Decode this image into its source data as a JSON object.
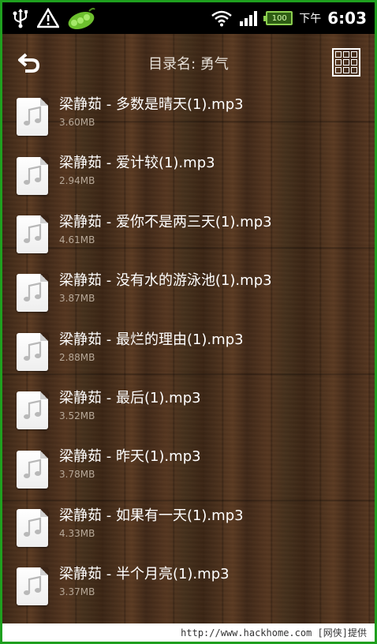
{
  "status_bar": {
    "ampm": "下午",
    "time": "6:03",
    "battery_label": "100",
    "icons": [
      "usb-icon",
      "warning-icon",
      "pea-app-icon",
      "wifi-icon",
      "signal-icon",
      "battery-icon"
    ]
  },
  "header": {
    "title": "目录名: 勇气",
    "back_icon": "back-arrow-icon",
    "grid_icon": "grid-view-icon"
  },
  "files": [
    {
      "name": "梁静茹 - 多数是晴天(1).mp3",
      "size": "3.60MB"
    },
    {
      "name": "梁静茹 - 爱计较(1).mp3",
      "size": "2.94MB"
    },
    {
      "name": "梁静茹 - 爱你不是两三天(1).mp3",
      "size": "4.61MB"
    },
    {
      "name": "梁静茹 - 没有水的游泳池(1).mp3",
      "size": "3.87MB"
    },
    {
      "name": "梁静茹 - 最烂的理由(1).mp3",
      "size": "2.88MB"
    },
    {
      "name": "梁静茹 - 最后(1).mp3",
      "size": "3.52MB"
    },
    {
      "name": "梁静茹 - 昨天(1).mp3",
      "size": "3.78MB"
    },
    {
      "name": "梁静茹 - 如果有一天(1).mp3",
      "size": "4.33MB"
    },
    {
      "name": "梁静茹 - 半个月亮(1).mp3",
      "size": "3.37MB"
    }
  ],
  "footer": {
    "watermark": "http://www.hackhome.com [网侠]提供"
  },
  "colors": {
    "frame_green": "#1fa01f",
    "wood_dark": "#3a2416",
    "text_white": "#ffffff",
    "size_text": "#b7a898"
  }
}
